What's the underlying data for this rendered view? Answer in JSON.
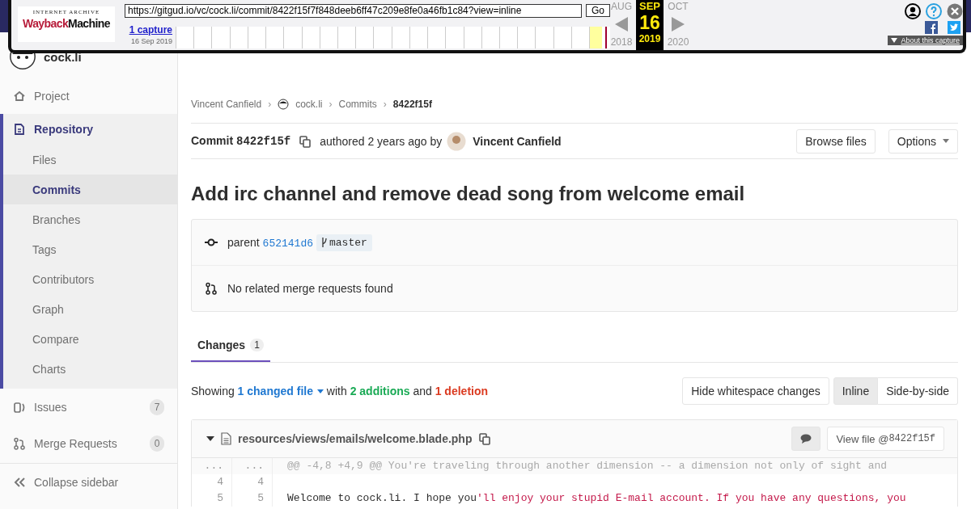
{
  "wayback": {
    "logo_top": "INTERNET ARCHIVE",
    "logo_wayback": "Wayback",
    "logo_machine": "Machine",
    "url": "https://gitgud.io/vc/cock.li/commit/8422f15f7f848deeb6ff47c209e8fe0a46fb1c84?view=inline",
    "go_button": "Go",
    "captures_link": "1 capture",
    "capture_date": "16 Sep 2019",
    "prev_month": "AUG",
    "month": "SEP",
    "day": "16",
    "year": "2019",
    "next_month": "OCT",
    "prev_year": "2018",
    "next_year": "2020",
    "about_link": "About this capture"
  },
  "sidebar": {
    "project_name": "cock.li",
    "items": [
      {
        "label": "Project",
        "selected": false
      },
      {
        "label": "Repository",
        "selected": true,
        "children": [
          {
            "label": "Files",
            "selected": false
          },
          {
            "label": "Commits",
            "selected": true
          },
          {
            "label": "Branches",
            "selected": false
          },
          {
            "label": "Tags",
            "selected": false
          },
          {
            "label": "Contributors",
            "selected": false
          },
          {
            "label": "Graph",
            "selected": false
          },
          {
            "label": "Compare",
            "selected": false
          },
          {
            "label": "Charts",
            "selected": false
          }
        ]
      },
      {
        "label": "Issues",
        "selected": false,
        "count": "7"
      },
      {
        "label": "Merge Requests",
        "selected": false,
        "count": "0"
      }
    ],
    "collapse": "Collapse sidebar"
  },
  "breadcrumbs": [
    {
      "label": "Vincent Canfield",
      "kind": "link"
    },
    {
      "separator": "›",
      "label": "cock.li",
      "kind": "project"
    },
    {
      "separator": "›",
      "label": "Commits",
      "kind": "link"
    },
    {
      "separator": "›",
      "label": "8422f15f",
      "kind": "current"
    }
  ],
  "commit": {
    "label": "Commit",
    "sha": "8422f15f",
    "authored": "authored 2 years ago by",
    "author": "Vincent Canfield",
    "browse_button": "Browse files",
    "options_button": "Options"
  },
  "title": "Add irc channel and remove dead song from welcome email",
  "info": {
    "parent_label": "parent",
    "parent_sha": "652141d6",
    "branch": "master",
    "merge_requests": "No related merge requests found"
  },
  "tabs": [
    {
      "label": "Changes",
      "count": "1",
      "selected": true
    }
  ],
  "summary": [
    {
      "text": "Showing ",
      "kind": "plain"
    },
    {
      "text": "1 changed file",
      "kind": "link"
    },
    {
      "text": " with ",
      "kind": "plain"
    },
    {
      "text": "2 additions",
      "kind": "add"
    },
    {
      "text": " and ",
      "kind": "plain"
    },
    {
      "text": "1 deletion",
      "kind": "del"
    }
  ],
  "whitespace_button": "Hide whitespace changes",
  "view_modes": [
    {
      "label": "Inline",
      "selected": true
    },
    {
      "label": "Side-by-side",
      "selected": false
    }
  ],
  "file": {
    "path": "resources/views/emails/welcome.blade.php",
    "view_file": "View file @ ",
    "view_sha": "8422f15f",
    "lines": [
      {
        "old": "...",
        "new": "...",
        "kind": "hunk",
        "parts": [
          {
            "text": "@@ -4,8 +4,9 @@ You're traveling through another dimension -- a dimension not only of sight and",
            "kind": "meta"
          }
        ]
      },
      {
        "old": "4",
        "new": "4",
        "kind": "context"
      },
      {
        "old": "5",
        "new": "5",
        "kind": "context",
        "parts": [
          {
            "text": "Welcome to cock.li. I hope you",
            "kind": "plain"
          },
          {
            "text": "'ll enjoy your stupid E-mail account. If you have any questions, you",
            "kind": "string"
          }
        ]
      }
    ]
  }
}
